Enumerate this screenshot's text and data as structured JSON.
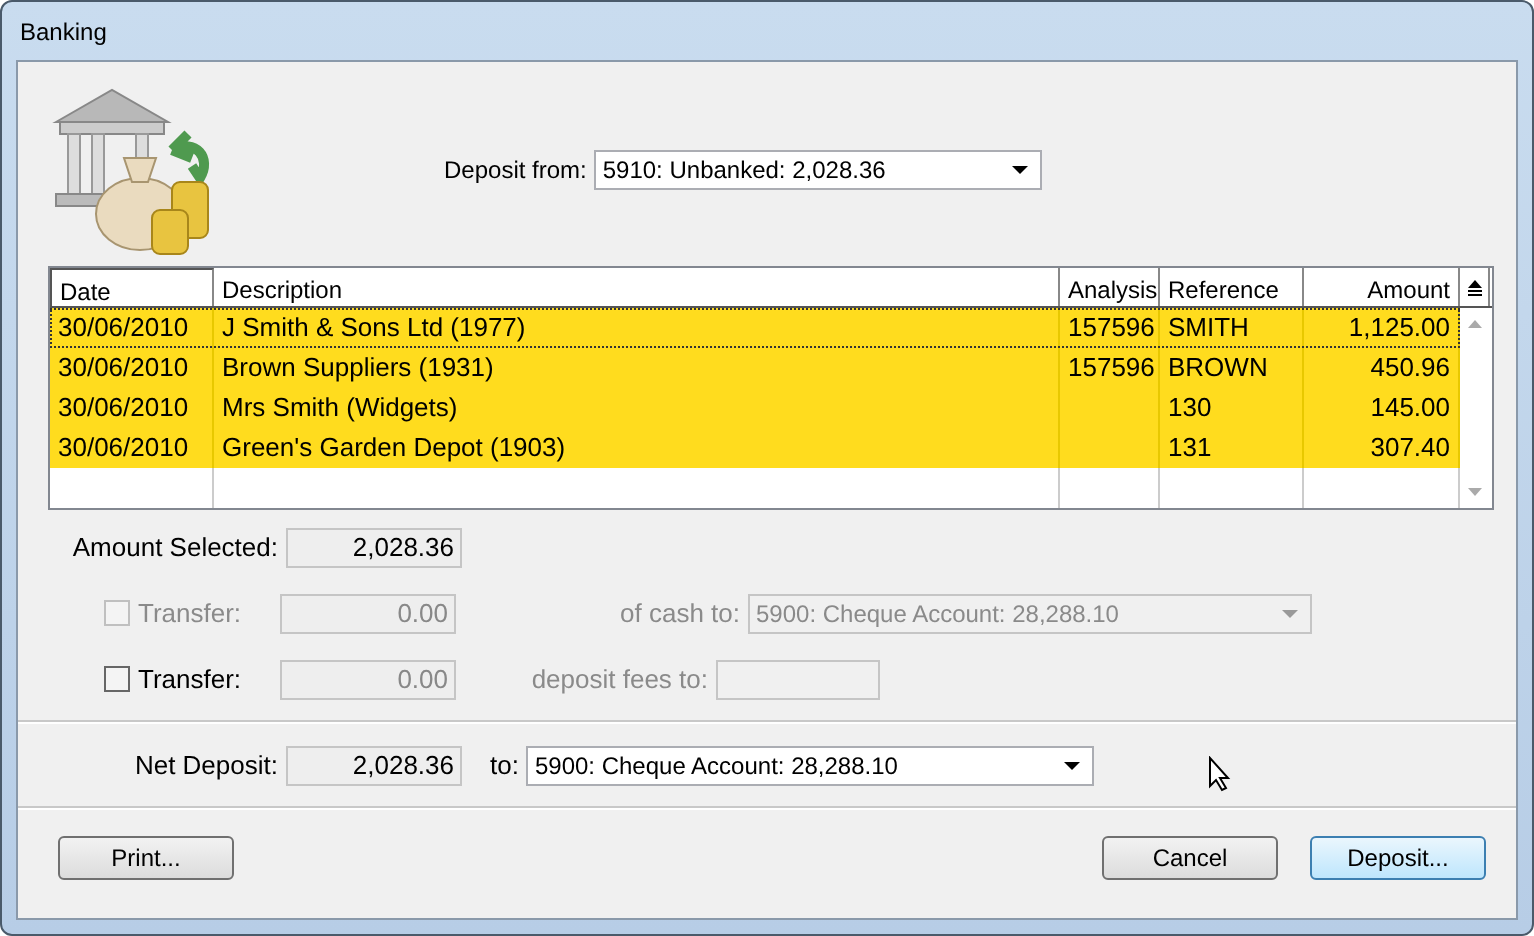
{
  "window": {
    "title": "Banking"
  },
  "deposit_from": {
    "label": "Deposit from:",
    "value": "5910: Unbanked: 2,028.36"
  },
  "table": {
    "columns": [
      "Date",
      "Description",
      "Analysis",
      "Reference",
      "Amount"
    ],
    "rows": [
      {
        "cells": [
          "30/06/2010",
          "J Smith & Sons Ltd (1977)",
          "157596",
          "SMITH",
          "1,125.00"
        ],
        "selected": true,
        "focused": true
      },
      {
        "cells": [
          "30/06/2010",
          "Brown Suppliers (1931)",
          "157596",
          "BROWN",
          "450.96"
        ],
        "selected": true,
        "focused": false
      },
      {
        "cells": [
          "30/06/2010",
          "Mrs Smith (Widgets)",
          "",
          "130",
          "145.00"
        ],
        "selected": true,
        "focused": false
      },
      {
        "cells": [
          "30/06/2010",
          "Green's Garden Depot (1903)",
          "",
          "131",
          "307.40"
        ],
        "selected": true,
        "focused": false
      }
    ]
  },
  "amount_selected": {
    "label": "Amount Selected:",
    "value": "2,028.36"
  },
  "transfers": [
    {
      "label": "Transfer:",
      "checked": false,
      "disabled": true,
      "amount": "0.00",
      "target_label": "of cash to:",
      "kind": "combo",
      "target_value": "5900: Cheque Account: 28,288.10"
    },
    {
      "label": "Transfer:",
      "checked": false,
      "disabled": false,
      "amount": "0.00",
      "target_label": "deposit fees to:",
      "kind": "field"
    }
  ],
  "net_deposit": {
    "label": "Net Deposit:",
    "value": "2,028.36",
    "to_label": "to:",
    "to_value": "5900: Cheque Account: 28,288.10"
  },
  "buttons": {
    "left": [
      "Print..."
    ],
    "right": [
      {
        "label": "Cancel",
        "default": false
      },
      {
        "label": "Deposit...",
        "default": true
      }
    ]
  }
}
